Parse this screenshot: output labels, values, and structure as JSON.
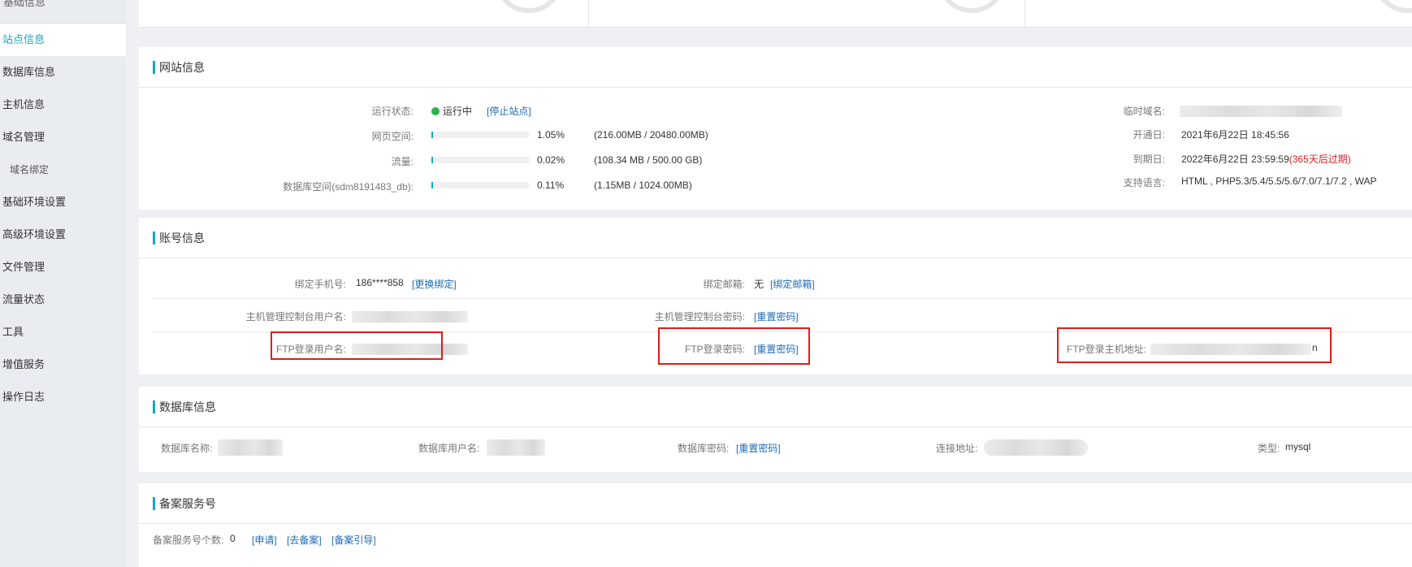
{
  "sidebar": {
    "header": "基础信息",
    "items": [
      {
        "label": "站点信息",
        "active": true
      },
      {
        "label": "数据库信息"
      },
      {
        "label": "主机信息"
      },
      {
        "label": "域名管理"
      },
      {
        "label": "域名绑定",
        "sub": true
      },
      {
        "label": "基础环境设置"
      },
      {
        "label": "高级环境设置"
      },
      {
        "label": "文件管理"
      },
      {
        "label": "流量状态"
      },
      {
        "label": "工具"
      },
      {
        "label": "增值服务"
      },
      {
        "label": "操作日志"
      }
    ]
  },
  "site": {
    "title": "网站信息",
    "run_status_label": "运行状态:",
    "run_status_value": "运行中",
    "stop_link": "[停止站点]",
    "web_space_label": "网页空间:",
    "web_space_pct": "1.05%",
    "web_space_detail": "(216.00MB / 20480.00MB)",
    "web_space_fill": 0.0105,
    "traffic_label": "流量:",
    "traffic_pct": "0.02%",
    "traffic_detail": "(108.34 MB / 500.00 GB)",
    "traffic_fill": 0.0002,
    "db_space_label": "数据库空间(sdm8191483_db):",
    "db_space_pct": "0.11%",
    "db_space_detail": "(1.15MB / 1024.00MB)",
    "db_space_fill": 0.0011,
    "temp_domain_label": "临时域名:",
    "open_label": "开通日:",
    "open_value": "2021年6月22日 18:45:56",
    "expire_label": "到期日:",
    "expire_value": "2022年6月22日 23:59:59",
    "expire_note": "(365天后过期)",
    "lang_label": "支持语言:",
    "lang_value": "HTML , PHP5.3/5.4/5.5/5.6/7.0/7.1/7.2 , WAP"
  },
  "account": {
    "title": "账号信息",
    "phone_label": "绑定手机号:",
    "phone_value": "186****858",
    "phone_link": "[更换绑定]",
    "email_label": "绑定邮箱:",
    "email_value": "无",
    "email_link": "[绑定邮箱]",
    "host_user_label": "主机管理控制台用户名:",
    "host_pwd_label": "主机管理控制台密码:",
    "host_pwd_link": "[重置密码]",
    "ftp_user_label": "FTP登录用户名:",
    "ftp_pwd_label": "FTP登录密码:",
    "ftp_pwd_link": "[重置密码]",
    "ftp_host_label": "FTP登录主机地址:",
    "ftp_host_tail": "n"
  },
  "database": {
    "title": "数据库信息",
    "name_label": "数据库名称:",
    "user_label": "数据库用户名:",
    "pwd_label": "数据库密码:",
    "pwd_link": "[重置密码]",
    "conn_label": "连接地址:",
    "type_label": "类型:",
    "type_value": "mysql"
  },
  "beian": {
    "title": "备案服务号",
    "count_label": "备案服务号个数:",
    "count_value": "0",
    "apply_link": "[申请]",
    "go_link": "[去备案]",
    "guide_link": "[备案引导]"
  },
  "colors": {
    "accent": "#14a6c9",
    "highlight": "#e21c1c",
    "running": "#2bb24c"
  }
}
